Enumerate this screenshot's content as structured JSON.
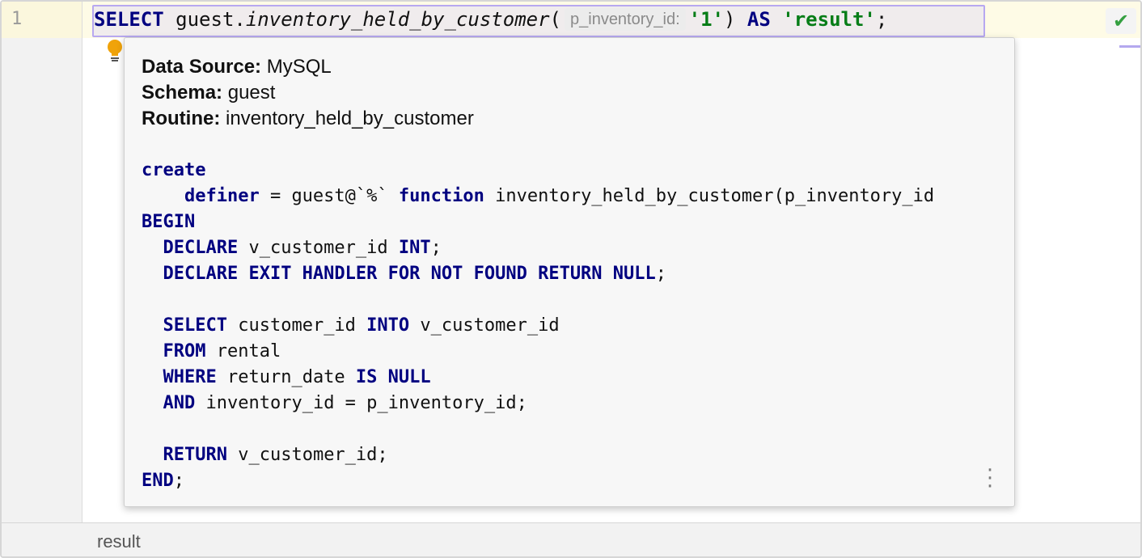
{
  "editor": {
    "line_number": "1",
    "line": {
      "kw_select": "SELECT",
      "schema_prefix": " guest.",
      "function_name": "inventory_held_by_customer",
      "open_paren": "(",
      "param_hint": "p_inventory_id:",
      "arg_value": "'1'",
      "close_paren": ")",
      "kw_as": "AS",
      "alias": "'result'",
      "semicolon": ";"
    }
  },
  "status_icon": "checkmark-icon",
  "intention_icon": "lightbulb-icon",
  "popup": {
    "meta": [
      {
        "label": "Data Source:",
        "value": " MySQL"
      },
      {
        "label": "Schema:",
        "value": " guest"
      },
      {
        "label": "Routine:",
        "value": " inventory_held_by_customer"
      }
    ],
    "code": {
      "l1_kw": "create",
      "l2_kw1": "definer",
      "l2_text1": " = guest@`%` ",
      "l2_kw2": "function",
      "l2_text2": " inventory_held_by_customer(p_inventory_id",
      "l3_kw": "BEGIN",
      "l4_kw1": "DECLARE",
      "l4_text": " v_customer_id ",
      "l4_kw2": "INT",
      "l4_tail": ";",
      "l5_kw": "DECLARE EXIT HANDLER FOR NOT FOUND RETURN NULL",
      "l5_tail": ";",
      "l7_kw1": "SELECT",
      "l7_text1": " customer_id ",
      "l7_kw2": "INTO",
      "l7_text2": " v_customer_id",
      "l8_kw": "FROM",
      "l8_text": " rental",
      "l9_kw1": "WHERE",
      "l9_text": " return_date ",
      "l9_kw2": "IS NULL",
      "l10_kw": "AND",
      "l10_text": " inventory_id = p_inventory_id;",
      "l12_kw": "RETURN",
      "l12_text": " v_customer_id;",
      "l13_kw": "END",
      "l13_tail": ";"
    },
    "more_icon": "more-vertical-icon"
  },
  "results_tab": {
    "label": "result"
  }
}
